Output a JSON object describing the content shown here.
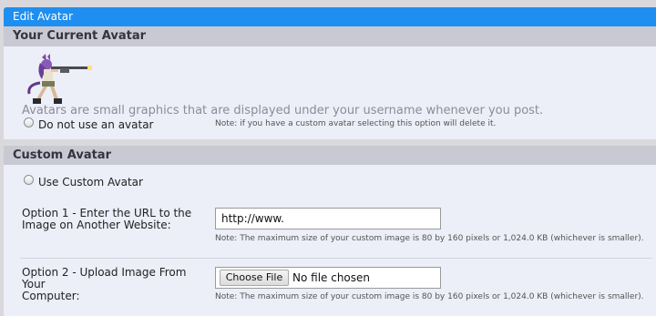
{
  "window": {
    "title": "Edit Avatar"
  },
  "current_avatar": {
    "heading": "Your Current Avatar",
    "description": "Avatars are small graphics that are displayed under your username whenever you post.",
    "no_avatar_label": "Do not use an avatar",
    "no_avatar_note": "Note: if you have a custom avatar selecting this option will delete it."
  },
  "custom_avatar": {
    "heading": "Custom Avatar",
    "use_custom_label": "Use Custom Avatar",
    "option1": {
      "label_line1": "Option 1 - Enter the URL to the",
      "label_line2": "Image on Another Website:",
      "value": "http://www.",
      "note": "Note: The maximum size of your custom image is 80 by 160 pixels or 1,024.0 KB (whichever is smaller)."
    },
    "option2": {
      "label_line1": "Option 2 - Upload Image From Your",
      "label_line2": "Computer:",
      "button": "Choose File",
      "status": "No file chosen",
      "note": "Note: The maximum size of your custom image is 80 by 160 pixels or 1,024.0 KB (whichever is smaller)."
    }
  },
  "colors": {
    "titlebar": "#1e8ff0",
    "section_header": "#c8c9d3",
    "panel": "#eceef8"
  },
  "icons": {
    "avatar_image": "avatar-image"
  }
}
